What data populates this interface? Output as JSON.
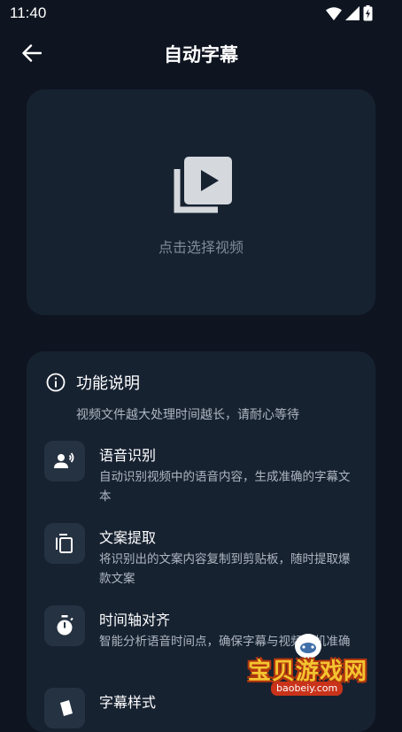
{
  "status_bar": {
    "time": "11:40"
  },
  "app_bar": {
    "title": "自动字幕"
  },
  "video_card": {
    "hint": "点击选择视频"
  },
  "info": {
    "title": "功能说明",
    "subtitle": "视频文件越大处理时间越长，请耐心等待",
    "features": [
      {
        "title": "语音识别",
        "desc": "自动识别视频中的语音内容，生成准确的字幕文本",
        "icon": "voice-recognition-icon"
      },
      {
        "title": "文案提取",
        "desc": "将识别出的文案内容复制到剪贴板，随时提取爆款文案",
        "icon": "copy-icon"
      },
      {
        "title": "时间轴对齐",
        "desc": "智能分析语音时间点，确保字幕与视频对机准确",
        "icon": "timer-icon"
      },
      {
        "title": "字幕样式",
        "desc": "",
        "icon": "style-icon"
      }
    ]
  },
  "watermark": {
    "name": "宝贝游戏网",
    "url": "baobeiy.com"
  },
  "colors": {
    "background": "#0e1520",
    "card": "#172231",
    "icon_tile": "#253241",
    "muted_text": "#7f8a97"
  }
}
